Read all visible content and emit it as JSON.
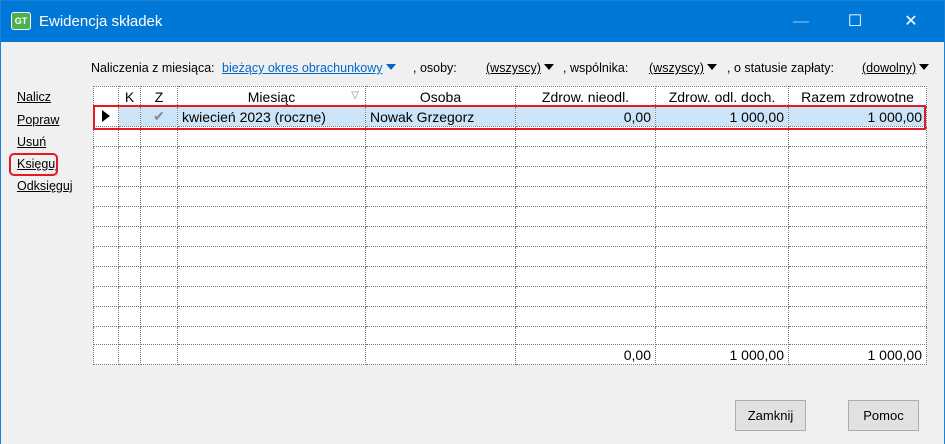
{
  "window": {
    "title": "Ewidencja składek",
    "icon_name": "app-icon",
    "icon_text": "GT",
    "controls": {
      "minimize_glyph": "—",
      "maximize_glyph": "☐",
      "close_glyph": "✕"
    }
  },
  "filters": {
    "month_label": "Naliczenia z miesiąca:",
    "month_value": "bieżący okres obrachunkowy",
    "person_label": ", osoby:",
    "person_value": "(wszyscy)",
    "partner_label": ", wspólnika:",
    "partner_value": "(wszyscy)",
    "status_label": ", o statusie zapłaty:",
    "status_value": "(dowolny)"
  },
  "actions": [
    "Nalicz",
    "Popraw",
    "Usuń",
    "Księguj",
    "Odksięguj"
  ],
  "table": {
    "columns": [
      "",
      "K",
      "Z",
      "Miesiąc",
      "Osoba",
      "Zdrow. nieodl.",
      "Zdrow. odl. doch.",
      "Razem zdrowotne"
    ],
    "rows": [
      {
        "k": "",
        "z": "✔",
        "miesiac": "kwiecień 2023 (roczne)",
        "osoba": "Nowak Grzegorz",
        "nieodl": "0,00",
        "odl": "1 000,00",
        "razem": "1 000,00"
      }
    ],
    "totals": {
      "nieodl": "0,00",
      "odl": "1 000,00",
      "razem": "1 000,00"
    }
  },
  "buttons": {
    "close": "Zamknij",
    "help": "Pomoc"
  }
}
